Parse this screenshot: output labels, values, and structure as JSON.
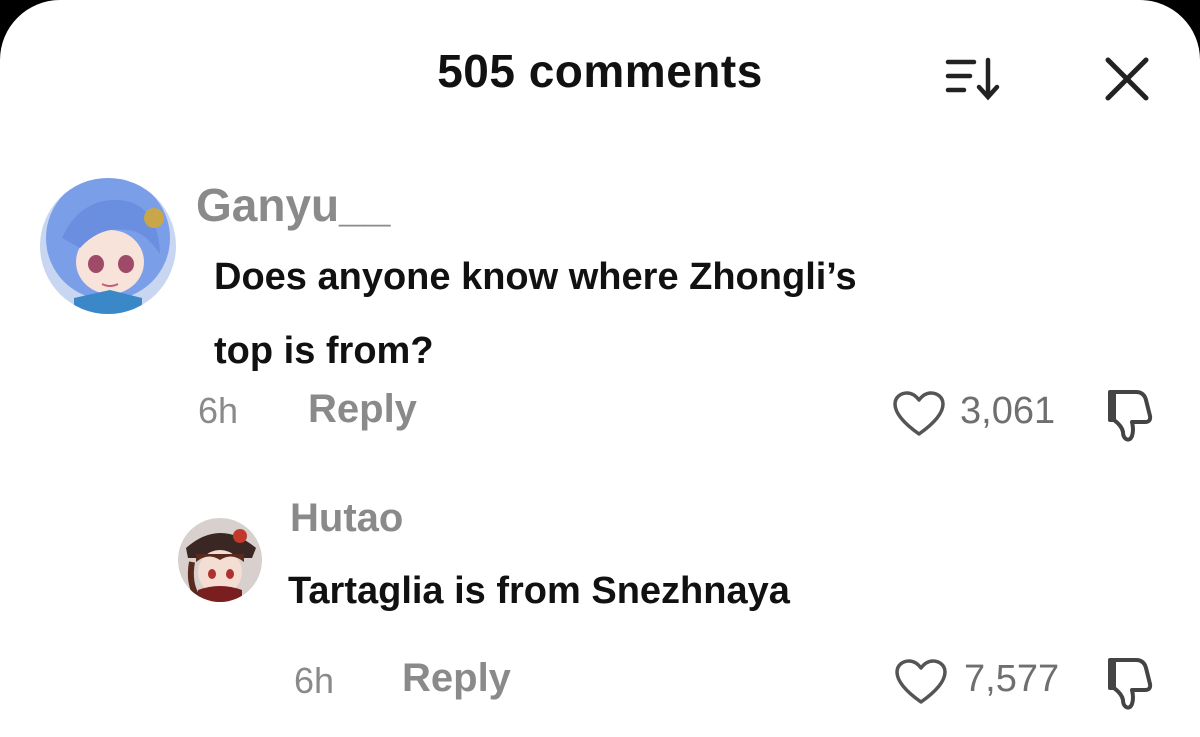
{
  "header": {
    "title": "505 comments",
    "sort_icon": "sort-icon",
    "close_icon": "close-icon"
  },
  "comments": [
    {
      "username": "Ganyu__",
      "text_lines": [
        "Does anyone know where Zhongli’s",
        "top is from?"
      ],
      "time": "6h",
      "reply_label": "Reply",
      "likes": "3,061",
      "avatar": "ganyu-avatar",
      "colors": {
        "hair": "#7b9ee8"
      }
    },
    {
      "username": "Hutao",
      "text_lines": [
        "Tartaglia is from Snezhnaya"
      ],
      "time": "6h",
      "reply_label": "Reply",
      "likes": "7,577",
      "avatar": "hutao-avatar",
      "colors": {
        "hair": "#5a2a1e"
      }
    }
  ]
}
